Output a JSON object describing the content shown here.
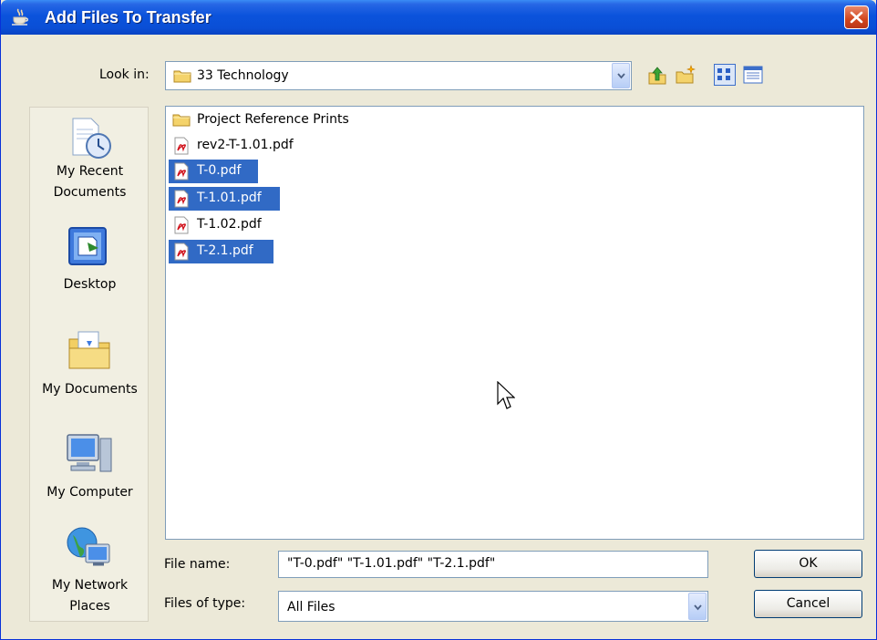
{
  "window": {
    "title": "Add Files To Transfer"
  },
  "toolbar": {
    "look_in_label": "Look in:",
    "look_in_value": "33 Technology",
    "icons": [
      "up-one-level-icon",
      "create-new-folder-icon",
      "list-view-icon",
      "details-view-icon"
    ]
  },
  "places": [
    {
      "label": "My Recent Documents",
      "icon": "recent-documents-icon"
    },
    {
      "label": "Desktop",
      "icon": "desktop-icon"
    },
    {
      "label": "My Documents",
      "icon": "my-documents-icon"
    },
    {
      "label": "My Computer",
      "icon": "my-computer-icon"
    },
    {
      "label": "My Network Places",
      "icon": "network-places-icon"
    }
  ],
  "files": [
    {
      "name": "Project Reference Prints",
      "type": "folder",
      "selected": false
    },
    {
      "name": "rev2-T-1.01.pdf",
      "type": "pdf",
      "selected": false
    },
    {
      "name": "T-0.pdf",
      "type": "pdf",
      "selected": true
    },
    {
      "name": "T-1.01.pdf",
      "type": "pdf",
      "selected": true
    },
    {
      "name": "T-1.02.pdf",
      "type": "pdf",
      "selected": false
    },
    {
      "name": "T-2.1.pdf",
      "type": "pdf",
      "selected": true
    }
  ],
  "form": {
    "file_name_label": "File name:",
    "file_name_value": "\"T-0.pdf\" \"T-1.01.pdf\" \"T-2.1.pdf\"",
    "files_of_type_label": "Files of type:",
    "files_of_type_value": "All Files"
  },
  "buttons": {
    "ok": "OK",
    "cancel": "Cancel"
  },
  "colors": {
    "selection": "#316ac5",
    "titlebar": "#0a4fd6",
    "dialog_bg": "#ece9d8"
  }
}
